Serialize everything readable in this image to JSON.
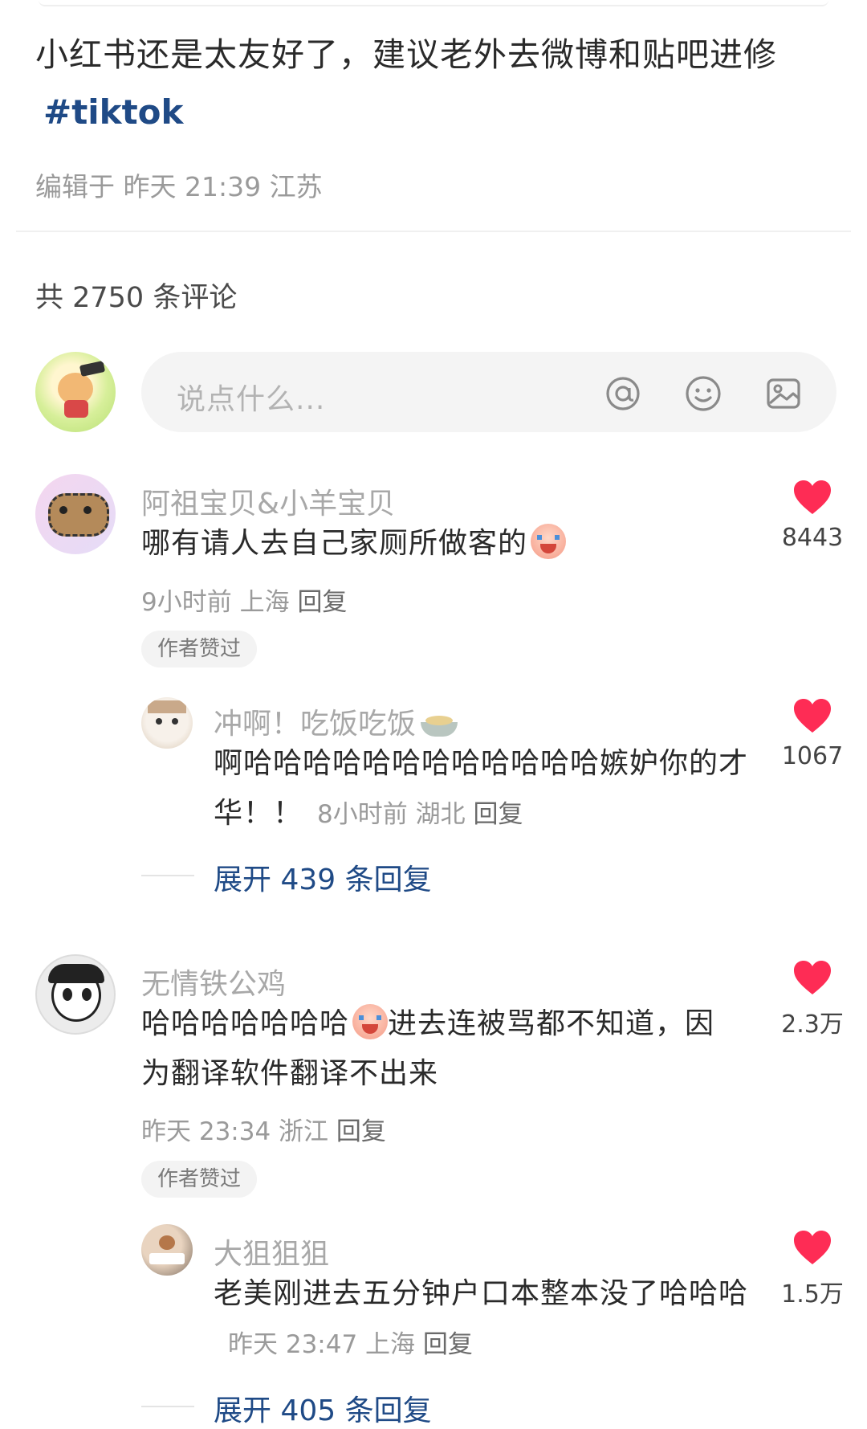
{
  "post": {
    "text": "小红书还是太友好了，建议老外去微博和贴吧进修",
    "hashtag": "#tiktok",
    "edited": "编辑于 昨天 21:39 江苏"
  },
  "comments_header": {
    "count_text": "共 2750 条评论"
  },
  "input": {
    "placeholder": "说点什么...",
    "icons": [
      "at-icon",
      "emoji-icon",
      "image-icon"
    ]
  },
  "colors": {
    "heart": "#fe2c55",
    "link": "#1f4a86"
  },
  "comments": [
    {
      "username": "阿祖宝贝&小羊宝贝",
      "text": "哪有请人去自己家厕所做客的",
      "emoji": "crying-laugh-icon",
      "meta": "9小时前 上海",
      "reply": "回复",
      "badge": "作者赞过",
      "likes": "8443",
      "sub_reply": {
        "username": "冲啊！吃饭吃饭",
        "user_emoji": "bowl-icon",
        "text": "啊哈哈哈哈哈哈哈哈哈哈哈哈嫉妒你的才华！！",
        "meta": "8小时前 湖北",
        "reply": "回复",
        "likes": "1067"
      },
      "expand": "展开 439 条回复"
    },
    {
      "username": "无情铁公鸡",
      "text_a": "哈哈哈哈哈哈哈",
      "emoji": "crying-laugh-icon",
      "text_b": "进去连被骂都不知道，因为翻译软件翻译不出来",
      "meta": "昨天 23:34 浙江",
      "reply": "回复",
      "badge": "作者赞过",
      "likes": "2.3万",
      "sub_reply": {
        "username": "大狙狙狙",
        "text": "老美刚进去五分钟户口本整本没了哈哈哈",
        "meta": "昨天 23:47 上海",
        "reply": "回复",
        "likes": "1.5万"
      },
      "expand": "展开 405 条回复"
    }
  ]
}
